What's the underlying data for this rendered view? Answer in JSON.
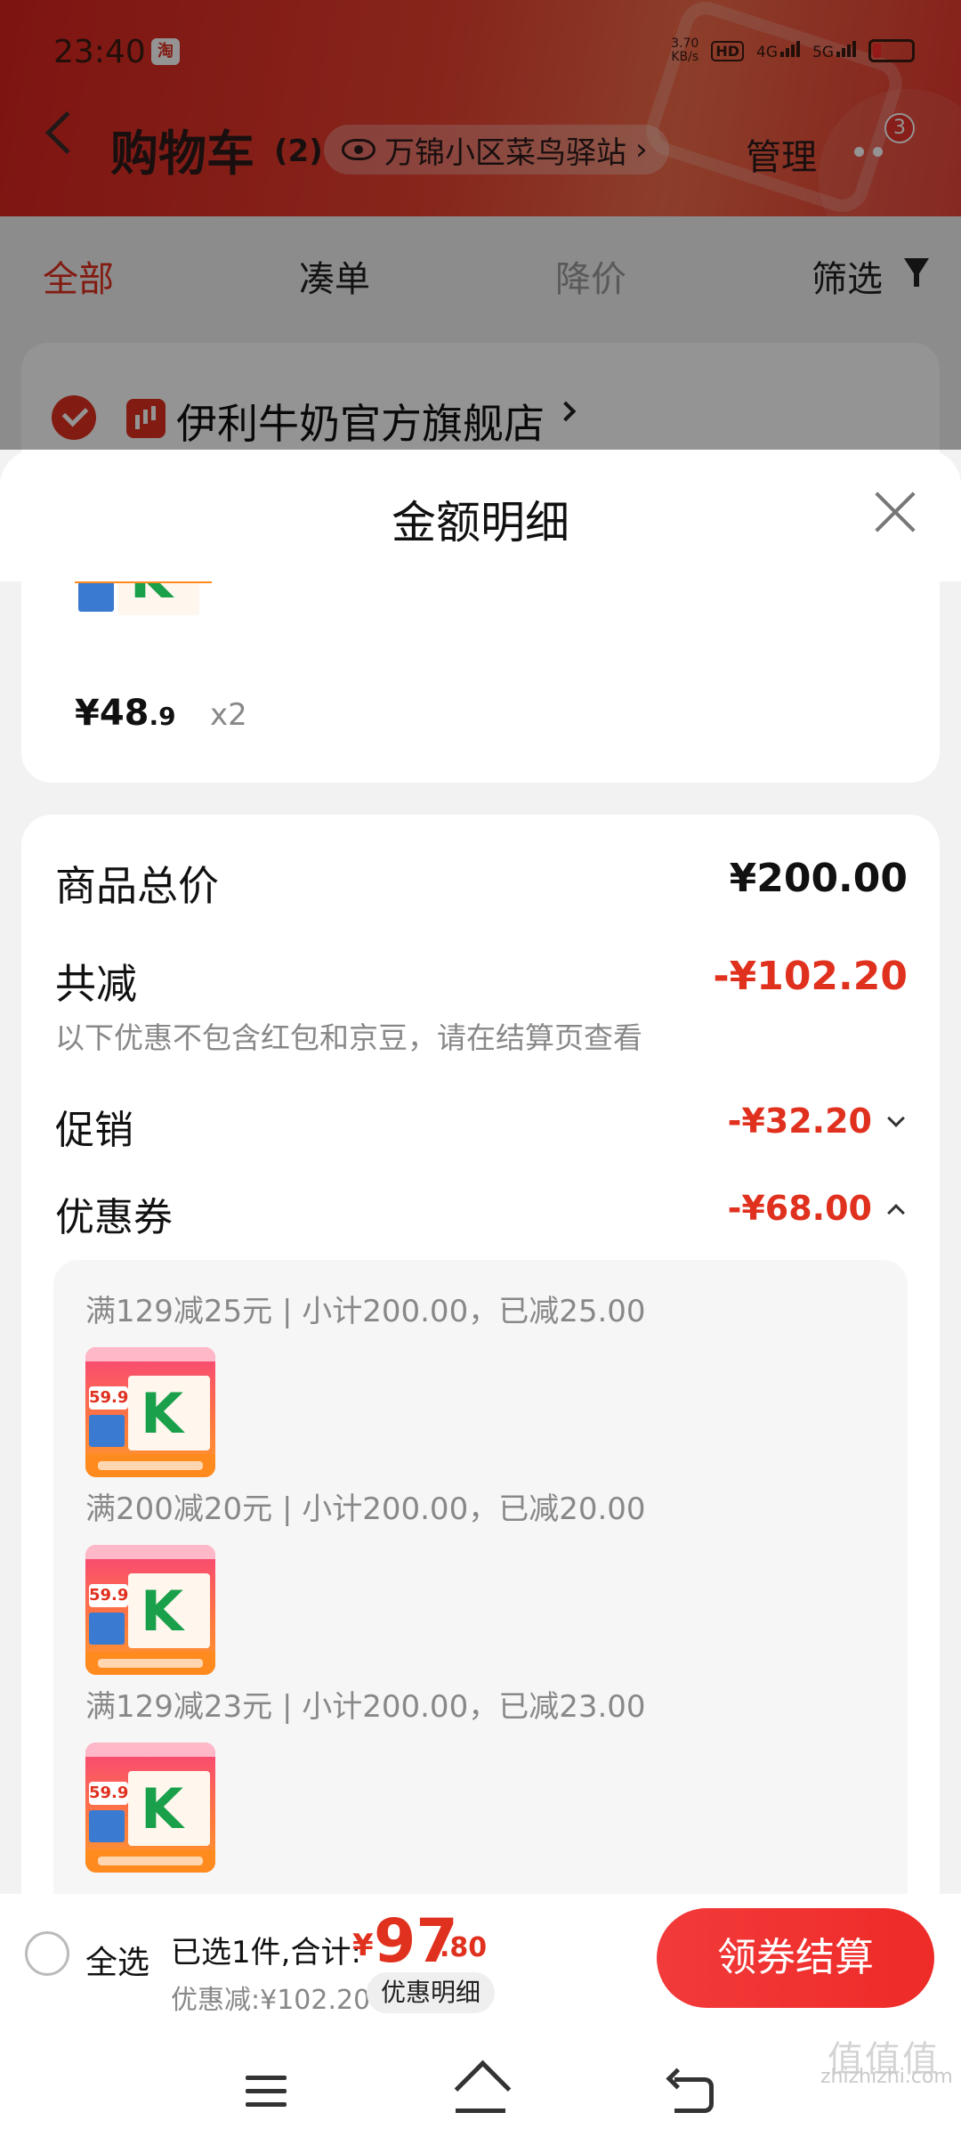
{
  "status_bar": {
    "time": "23:40",
    "app_badge": "淘",
    "net_speed_value": "3.70",
    "net_speed_unit": "KB/s",
    "hd_label": "HD",
    "net_4g": "4G",
    "net_5g": "5G"
  },
  "header": {
    "title": "购物车",
    "count": "(2)",
    "location": "万锦小区菜鸟驿站",
    "location_chevron": "›",
    "manage": "管理",
    "badge_count": "3"
  },
  "tabs": [
    {
      "label": "全部",
      "active": true
    },
    {
      "label": "凑单"
    },
    {
      "label": "降价"
    },
    {
      "label": "筛选"
    }
  ],
  "store": {
    "name": "伊利牛奶官方旗舰店"
  },
  "sheet": {
    "title": "金额明细",
    "item": {
      "price_symbol": "¥",
      "price_int": "48",
      "price_dec": ".9",
      "quantity": "x2"
    },
    "summary": {
      "total_label": "商品总价",
      "total_value": "¥200.00",
      "reduce_label": "共减",
      "reduce_value": "-¥102.20",
      "reduce_note": "以下优惠不包含红包和京豆，请在结算页查看",
      "promo_label": "促销",
      "promo_value": "-¥32.20",
      "coupon_label": "优惠券",
      "coupon_value": "-¥68.00"
    },
    "coupons": [
      {
        "desc": "满129减25元 | 小计200.00，已减25.00"
      },
      {
        "desc": "满200减20元 | 小计200.00，已减20.00"
      },
      {
        "desc": "满129减23元 | 小计200.00，已减23.00"
      }
    ],
    "thumb_price_tag": "59.9"
  },
  "bottom_bar": {
    "select_all": "全选",
    "selected_info": "已选1件,合计:",
    "total_symbol": "¥",
    "total_int": "97",
    "total_dec": ".80",
    "discount_line": "优惠减:¥102.20",
    "detail_button": "优惠明细",
    "checkout_button": "领券结算"
  },
  "watermark": {
    "logo": "值值值",
    "text": "zhizhizhi.com"
  },
  "colors": {
    "accent_red": "#e0301e",
    "checkout_red": "#ee2b28",
    "header_red": "#d9231f"
  }
}
